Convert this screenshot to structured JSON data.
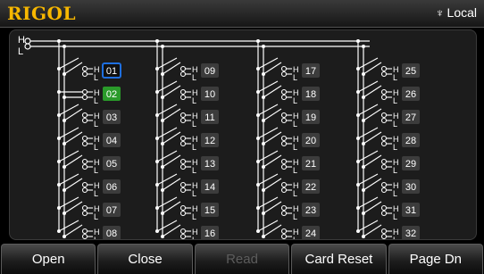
{
  "header": {
    "brand": "RIGOL",
    "status": "Local",
    "usb_icon": "usb-icon"
  },
  "bus_labels": {
    "h": "H",
    "l": "L"
  },
  "channels": [
    {
      "label": "01",
      "state": "selected"
    },
    {
      "label": "02",
      "state": "closed"
    },
    {
      "label": "03",
      "state": "open"
    },
    {
      "label": "04",
      "state": "open"
    },
    {
      "label": "05",
      "state": "open"
    },
    {
      "label": "06",
      "state": "open"
    },
    {
      "label": "07",
      "state": "open"
    },
    {
      "label": "08",
      "state": "open"
    },
    {
      "label": "09",
      "state": "open"
    },
    {
      "label": "10",
      "state": "open"
    },
    {
      "label": "11",
      "state": "open"
    },
    {
      "label": "12",
      "state": "open"
    },
    {
      "label": "13",
      "state": "open"
    },
    {
      "label": "14",
      "state": "open"
    },
    {
      "label": "15",
      "state": "open"
    },
    {
      "label": "16",
      "state": "open"
    },
    {
      "label": "17",
      "state": "open"
    },
    {
      "label": "18",
      "state": "open"
    },
    {
      "label": "19",
      "state": "open"
    },
    {
      "label": "20",
      "state": "open"
    },
    {
      "label": "21",
      "state": "open"
    },
    {
      "label": "22",
      "state": "open"
    },
    {
      "label": "23",
      "state": "open"
    },
    {
      "label": "24",
      "state": "open"
    },
    {
      "label": "25",
      "state": "open"
    },
    {
      "label": "26",
      "state": "open"
    },
    {
      "label": "27",
      "state": "open"
    },
    {
      "label": "28",
      "state": "open"
    },
    {
      "label": "29",
      "state": "open"
    },
    {
      "label": "30",
      "state": "open"
    },
    {
      "label": "31",
      "state": "open"
    },
    {
      "label": "32",
      "state": "open"
    }
  ],
  "softkeys": [
    {
      "label": "Open",
      "enabled": true
    },
    {
      "label": "Close",
      "enabled": true
    },
    {
      "label": "Read",
      "enabled": false
    },
    {
      "label": "Card Reset",
      "enabled": true
    },
    {
      "label": "Page Dn",
      "enabled": true
    }
  ],
  "colors": {
    "brand": "#f7b700",
    "selected_border": "#1e6fe0",
    "closed_fill": "#2a9a2a",
    "label_bg": "#3c3c3c"
  }
}
